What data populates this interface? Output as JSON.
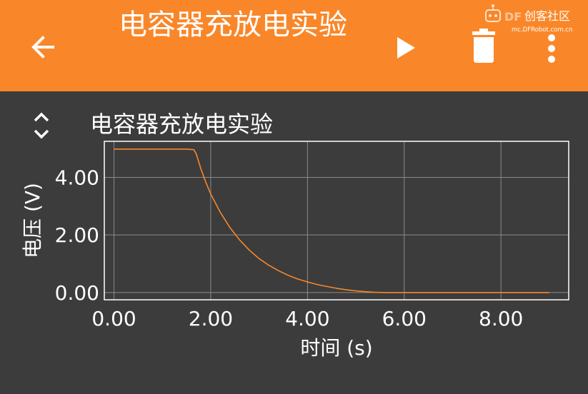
{
  "app_bar": {
    "title": "电容器充放电实验",
    "back_icon": "arrow-left-icon",
    "play_icon": "play-icon",
    "delete_icon": "trash-icon",
    "more_icon": "more-vertical-icon",
    "background": "#f98729"
  },
  "watermark": {
    "logo_text": "DF",
    "brand": "创客社区",
    "url": "mc.DFRobot.com.cn"
  },
  "chart_panel": {
    "collapse_icon": "chevron-up-down-icon",
    "title": "电容器充放电实验"
  },
  "chart_data": {
    "type": "line",
    "xlabel": "时间 (s)",
    "ylabel": "电压 (V)",
    "xlim": [
      -0.2,
      9.4
    ],
    "ylim": [
      -0.25,
      5.25
    ],
    "xticks": [
      0,
      2,
      4,
      6,
      8
    ],
    "xtick_labels": [
      "0.00",
      "2.00",
      "4.00",
      "6.00",
      "8.00"
    ],
    "yticks": [
      0,
      2,
      4
    ],
    "ytick_labels": [
      "0.00",
      "2.00",
      "4.00"
    ],
    "grid": true,
    "series": [
      {
        "color": "#f98729",
        "x": [
          0,
          0.5,
          1.0,
          1.5,
          1.65,
          1.7,
          1.8,
          1.9,
          2.0,
          2.2,
          2.4,
          2.6,
          2.8,
          3.0,
          3.2,
          3.4,
          3.6,
          3.8,
          4.0,
          4.2,
          4.4,
          4.6,
          4.8,
          5.0,
          5.2,
          5.4,
          5.6,
          6.0,
          7.0,
          8.0,
          9.0
        ],
        "y": [
          4.98,
          4.98,
          4.98,
          4.98,
          4.96,
          4.82,
          4.28,
          3.82,
          3.42,
          2.78,
          2.25,
          1.82,
          1.47,
          1.18,
          0.95,
          0.76,
          0.6,
          0.47,
          0.37,
          0.28,
          0.21,
          0.15,
          0.1,
          0.06,
          0.03,
          0.01,
          0.0,
          0.0,
          0.0,
          0.0,
          0.0
        ]
      }
    ]
  }
}
